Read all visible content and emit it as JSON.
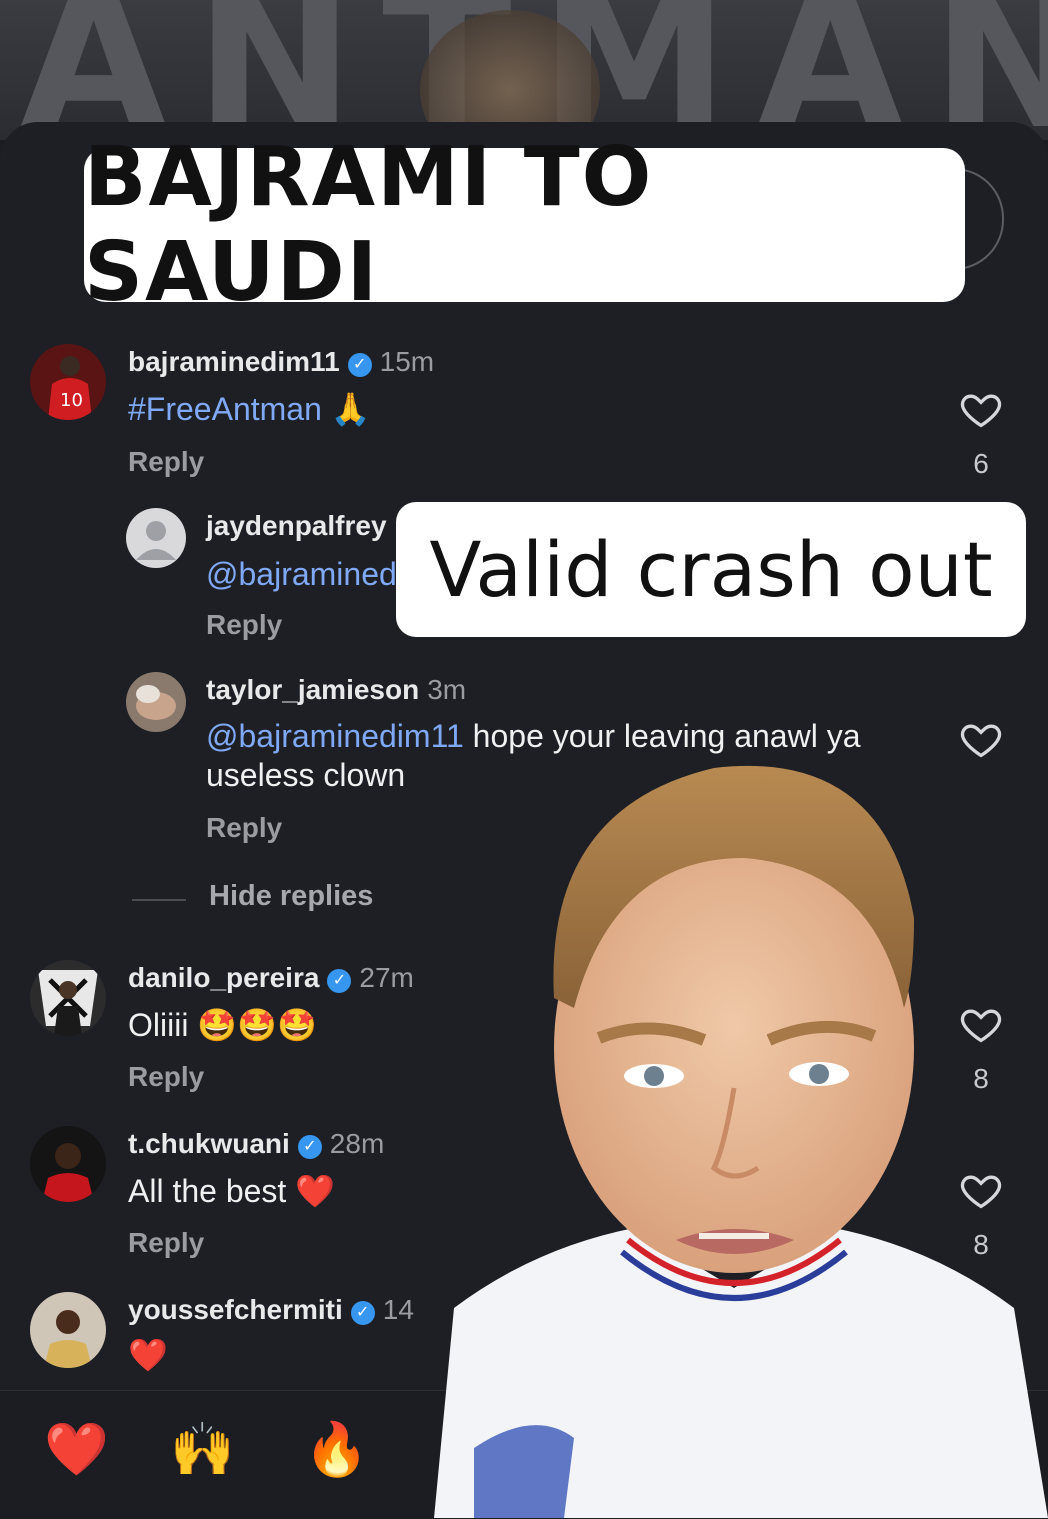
{
  "overlay": {
    "title": "BAJRAMI TO SAUDI",
    "caption": "Valid crash out"
  },
  "comments": [
    {
      "username": "bajraminedim11",
      "verified": true,
      "time": "15m",
      "text": "#FreeAntman",
      "emoji": "🙏",
      "reply": "Reply",
      "likes": "6"
    },
    {
      "username": "jaydenpalfrey",
      "verified": false,
      "time": "",
      "mention": "@bajraminedim11",
      "text": "",
      "reply": "Reply",
      "likes": ""
    },
    {
      "username": "taylor_jamieson",
      "verified": false,
      "time": "3m",
      "mention": "@bajraminedim11",
      "text": " hope your leaving anawl ya",
      "text2": "useless clown",
      "reply": "Reply",
      "likes": ""
    },
    {
      "username": "danilo_pereira",
      "verified": true,
      "time": "27m",
      "text": "Oliiii",
      "emoji": "🤩🤩🤩",
      "reply": "Reply",
      "likes": "8"
    },
    {
      "username": "t.chukwuani",
      "verified": true,
      "time": "28m",
      "text": "All the best",
      "emoji": "❤️",
      "reply": "Reply",
      "likes": "8"
    },
    {
      "username": "youssefchermiti",
      "verified": true,
      "time": "14",
      "text": "",
      "emoji": "❤️",
      "reply": "",
      "likes": ""
    }
  ],
  "hide_replies": "Hide replies",
  "quick_reactions": [
    "❤️",
    "🙌",
    "🔥"
  ],
  "icons": {
    "verified": "✓",
    "heart": "heart-outline-icon"
  },
  "colors": {
    "background": "#1d1f25",
    "mention": "#7fa8f5",
    "verified": "#3797f0"
  }
}
